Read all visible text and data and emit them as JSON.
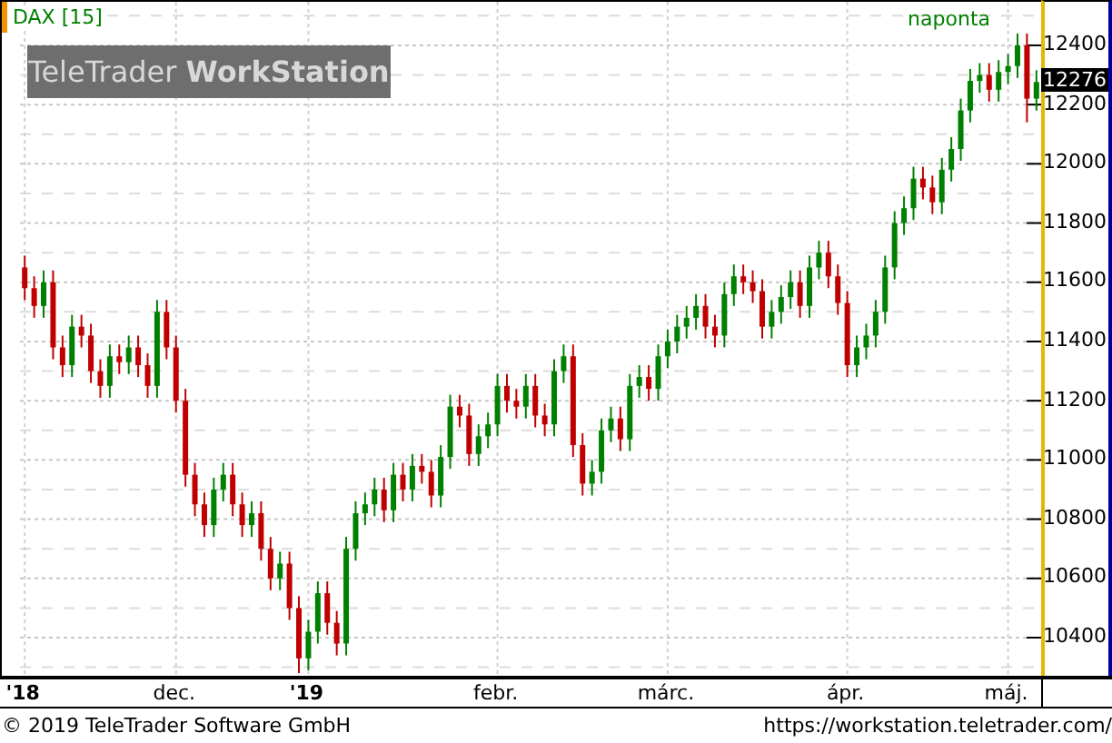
{
  "chart": {
    "symbol": "DAX [15]",
    "period": "naponta",
    "branding": {
      "light": "TeleTrader",
      "bold": "WorkStation"
    },
    "last_price": "12276",
    "chart_data": {
      "type": "candlestick",
      "ylim": [
        10265,
        12547
      ],
      "grid": true,
      "yticks": [
        10400,
        10600,
        10800,
        11000,
        11200,
        11400,
        11600,
        11800,
        12000,
        12200,
        12400
      ],
      "categories": [
        "'18",
        null,
        null,
        null,
        null,
        null,
        null,
        null,
        null,
        null,
        null,
        null,
        null,
        null,
        null,
        null,
        "dec.",
        null,
        null,
        null,
        null,
        null,
        null,
        null,
        null,
        null,
        null,
        null,
        null,
        null,
        "'19",
        null,
        null,
        null,
        null,
        null,
        null,
        null,
        null,
        null,
        null,
        null,
        null,
        null,
        null,
        null,
        null,
        null,
        null,
        null,
        "febr.",
        null,
        null,
        null,
        null,
        null,
        null,
        null,
        null,
        null,
        null,
        null,
        null,
        null,
        null,
        null,
        null,
        null,
        "márc.",
        null,
        null,
        null,
        null,
        null,
        null,
        null,
        null,
        null,
        null,
        null,
        null,
        null,
        null,
        null,
        null,
        null,
        null,
        "ápr.",
        null,
        null,
        null,
        null,
        null,
        null,
        null,
        null,
        null,
        null,
        null,
        null,
        null,
        null,
        null,
        null,
        "máj.",
        null,
        null,
        null
      ],
      "ohlc": [
        [
          11650,
          11690,
          11540,
          11580
        ],
        [
          11580,
          11620,
          11480,
          11520
        ],
        [
          11520,
          11640,
          11480,
          11600
        ],
        [
          11600,
          11640,
          11340,
          11380
        ],
        [
          11380,
          11420,
          11280,
          11320
        ],
        [
          11320,
          11490,
          11280,
          11450
        ],
        [
          11450,
          11490,
          11380,
          11420
        ],
        [
          11420,
          11460,
          11260,
          11300
        ],
        [
          11300,
          11340,
          11210,
          11250
        ],
        [
          11250,
          11390,
          11210,
          11350
        ],
        [
          11350,
          11390,
          11290,
          11330
        ],
        [
          11330,
          11420,
          11290,
          11380
        ],
        [
          11380,
          11420,
          11280,
          11320
        ],
        [
          11320,
          11360,
          11210,
          11250
        ],
        [
          11250,
          11540,
          11210,
          11500
        ],
        [
          11500,
          11540,
          11340,
          11380
        ],
        [
          11380,
          11420,
          11160,
          11200
        ],
        [
          11200,
          11240,
          10910,
          10950
        ],
        [
          10950,
          10990,
          10810,
          10850
        ],
        [
          10850,
          10890,
          10740,
          10780
        ],
        [
          10780,
          10940,
          10740,
          10900
        ],
        [
          10900,
          10990,
          10860,
          10950
        ],
        [
          10950,
          10990,
          10810,
          10850
        ],
        [
          10850,
          10890,
          10740,
          10780
        ],
        [
          10780,
          10860,
          10740,
          10820
        ],
        [
          10820,
          10860,
          10660,
          10700
        ],
        [
          10700,
          10740,
          10560,
          10600
        ],
        [
          10600,
          10690,
          10560,
          10650
        ],
        [
          10650,
          10690,
          10460,
          10500
        ],
        [
          10500,
          10540,
          10280,
          10330
        ],
        [
          10330,
          10460,
          10290,
          10420
        ],
        [
          10420,
          10590,
          10380,
          10550
        ],
        [
          10550,
          10590,
          10410,
          10450
        ],
        [
          10450,
          10490,
          10340,
          10380
        ],
        [
          10380,
          10740,
          10340,
          10700
        ],
        [
          10700,
          10860,
          10660,
          10820
        ],
        [
          10820,
          10890,
          10780,
          10850
        ],
        [
          10850,
          10940,
          10810,
          10900
        ],
        [
          10900,
          10940,
          10790,
          10830
        ],
        [
          10830,
          10990,
          10790,
          10950
        ],
        [
          10950,
          10990,
          10860,
          10900
        ],
        [
          10900,
          11020,
          10860,
          10980
        ],
        [
          10980,
          11020,
          10920,
          10960
        ],
        [
          10960,
          11000,
          10840,
          10880
        ],
        [
          10880,
          11050,
          10840,
          11010
        ],
        [
          11010,
          11220,
          10970,
          11180
        ],
        [
          11180,
          11220,
          11110,
          11150
        ],
        [
          11150,
          11190,
          10980,
          11020
        ],
        [
          11020,
          11120,
          10980,
          11080
        ],
        [
          11080,
          11160,
          11040,
          11120
        ],
        [
          11120,
          11290,
          11080,
          11250
        ],
        [
          11250,
          11290,
          11160,
          11200
        ],
        [
          11200,
          11240,
          11140,
          11180
        ],
        [
          11180,
          11290,
          11140,
          11250
        ],
        [
          11250,
          11290,
          11110,
          11150
        ],
        [
          11150,
          11190,
          11080,
          11120
        ],
        [
          11120,
          11340,
          11080,
          11300
        ],
        [
          11300,
          11390,
          11260,
          11350
        ],
        [
          11350,
          11390,
          11010,
          11050
        ],
        [
          11050,
          11090,
          10880,
          10920
        ],
        [
          10920,
          11000,
          10880,
          10960
        ],
        [
          10960,
          11140,
          10920,
          11100
        ],
        [
          11100,
          11180,
          11060,
          11140
        ],
        [
          11140,
          11180,
          11030,
          11070
        ],
        [
          11070,
          11290,
          11030,
          11250
        ],
        [
          11250,
          11320,
          11210,
          11280
        ],
        [
          11280,
          11320,
          11200,
          11240
        ],
        [
          11240,
          11390,
          11200,
          11350
        ],
        [
          11350,
          11440,
          11310,
          11400
        ],
        [
          11400,
          11490,
          11360,
          11450
        ],
        [
          11450,
          11520,
          11410,
          11480
        ],
        [
          11480,
          11560,
          11440,
          11520
        ],
        [
          11520,
          11560,
          11410,
          11450
        ],
        [
          11450,
          11490,
          11380,
          11420
        ],
        [
          11420,
          11600,
          11380,
          11560
        ],
        [
          11560,
          11660,
          11520,
          11620
        ],
        [
          11620,
          11660,
          11560,
          11600
        ],
        [
          11600,
          11640,
          11530,
          11570
        ],
        [
          11570,
          11610,
          11410,
          11450
        ],
        [
          11450,
          11540,
          11410,
          11500
        ],
        [
          11500,
          11590,
          11460,
          11550
        ],
        [
          11550,
          11640,
          11510,
          11600
        ],
        [
          11600,
          11640,
          11480,
          11520
        ],
        [
          11520,
          11690,
          11480,
          11650
        ],
        [
          11650,
          11740,
          11610,
          11700
        ],
        [
          11700,
          11740,
          11580,
          11620
        ],
        [
          11620,
          11660,
          11490,
          11530
        ],
        [
          11530,
          11570,
          11280,
          11320
        ],
        [
          11320,
          11420,
          11280,
          11380
        ],
        [
          11380,
          11460,
          11340,
          11420
        ],
        [
          11420,
          11540,
          11380,
          11500
        ],
        [
          11500,
          11690,
          11460,
          11650
        ],
        [
          11650,
          11840,
          11610,
          11800
        ],
        [
          11800,
          11890,
          11760,
          11850
        ],
        [
          11850,
          11990,
          11810,
          11950
        ],
        [
          11950,
          11990,
          11880,
          11920
        ],
        [
          11920,
          11960,
          11830,
          11870
        ],
        [
          11870,
          12020,
          11830,
          11980
        ],
        [
          11980,
          12090,
          11940,
          12050
        ],
        [
          12050,
          12220,
          12010,
          12180
        ],
        [
          12180,
          12320,
          12140,
          12280
        ],
        [
          12280,
          12340,
          12240,
          12300
        ],
        [
          12300,
          12340,
          12210,
          12250
        ],
        [
          12250,
          12350,
          12210,
          12310
        ],
        [
          12310,
          12370,
          12270,
          12330
        ],
        [
          12330,
          12440,
          12290,
          12400
        ],
        [
          12400,
          12440,
          12140,
          12220
        ],
        [
          12220,
          12316,
          12180,
          12276
        ]
      ]
    }
  },
  "footer": {
    "copyright": "© 2019 TeleTrader Software GmbH",
    "url": "https://workstation.teletrader.com/"
  }
}
